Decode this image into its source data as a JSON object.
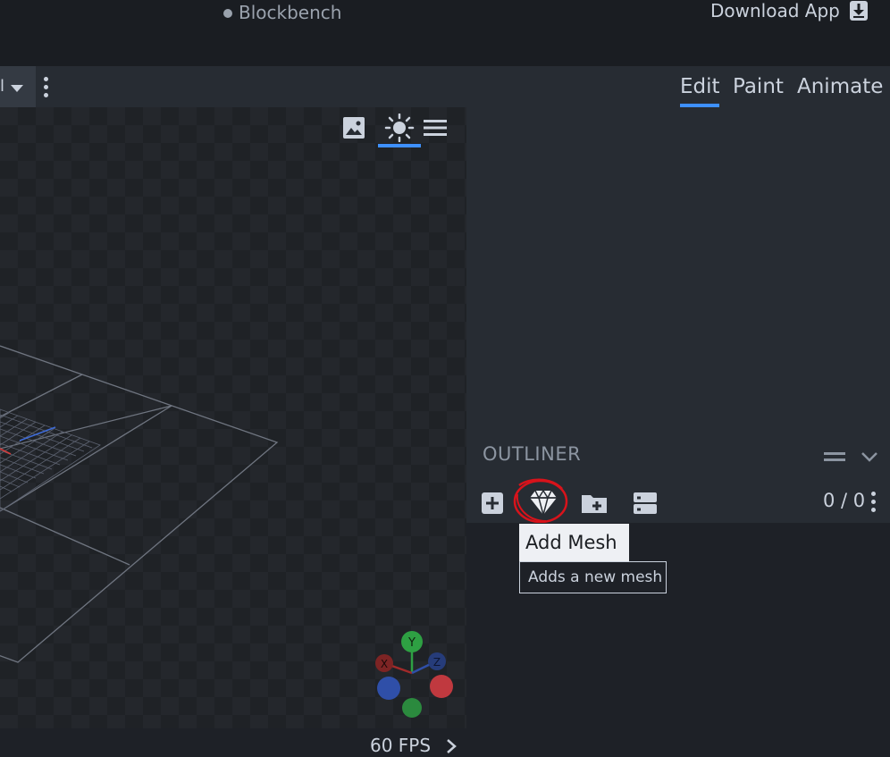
{
  "window": {
    "title": "Blockbench",
    "download_label": "Download App"
  },
  "toolbar": {
    "mode_select_value": "l"
  },
  "tabs": [
    {
      "label": "Edit",
      "active": true
    },
    {
      "label": "Paint"
    },
    {
      "label": "Animate"
    }
  ],
  "viewport": {
    "fps": "60 FPS"
  },
  "gizmo": {
    "y": "Y",
    "x": "X",
    "z": "Z"
  },
  "outliner": {
    "title": "OUTLINER",
    "count": "0 / 0",
    "tools": [
      "add-cube",
      "add-mesh",
      "add-group",
      "collapse-all"
    ]
  },
  "tooltip": {
    "title": "Add Mesh",
    "description": "Adds a new mesh"
  },
  "colors": {
    "accent": "#3e90ff",
    "axis_x": "#c0392b",
    "axis_y": "#2ea043",
    "axis_z": "#2f4fa8",
    "annotation": "#d8131b"
  }
}
